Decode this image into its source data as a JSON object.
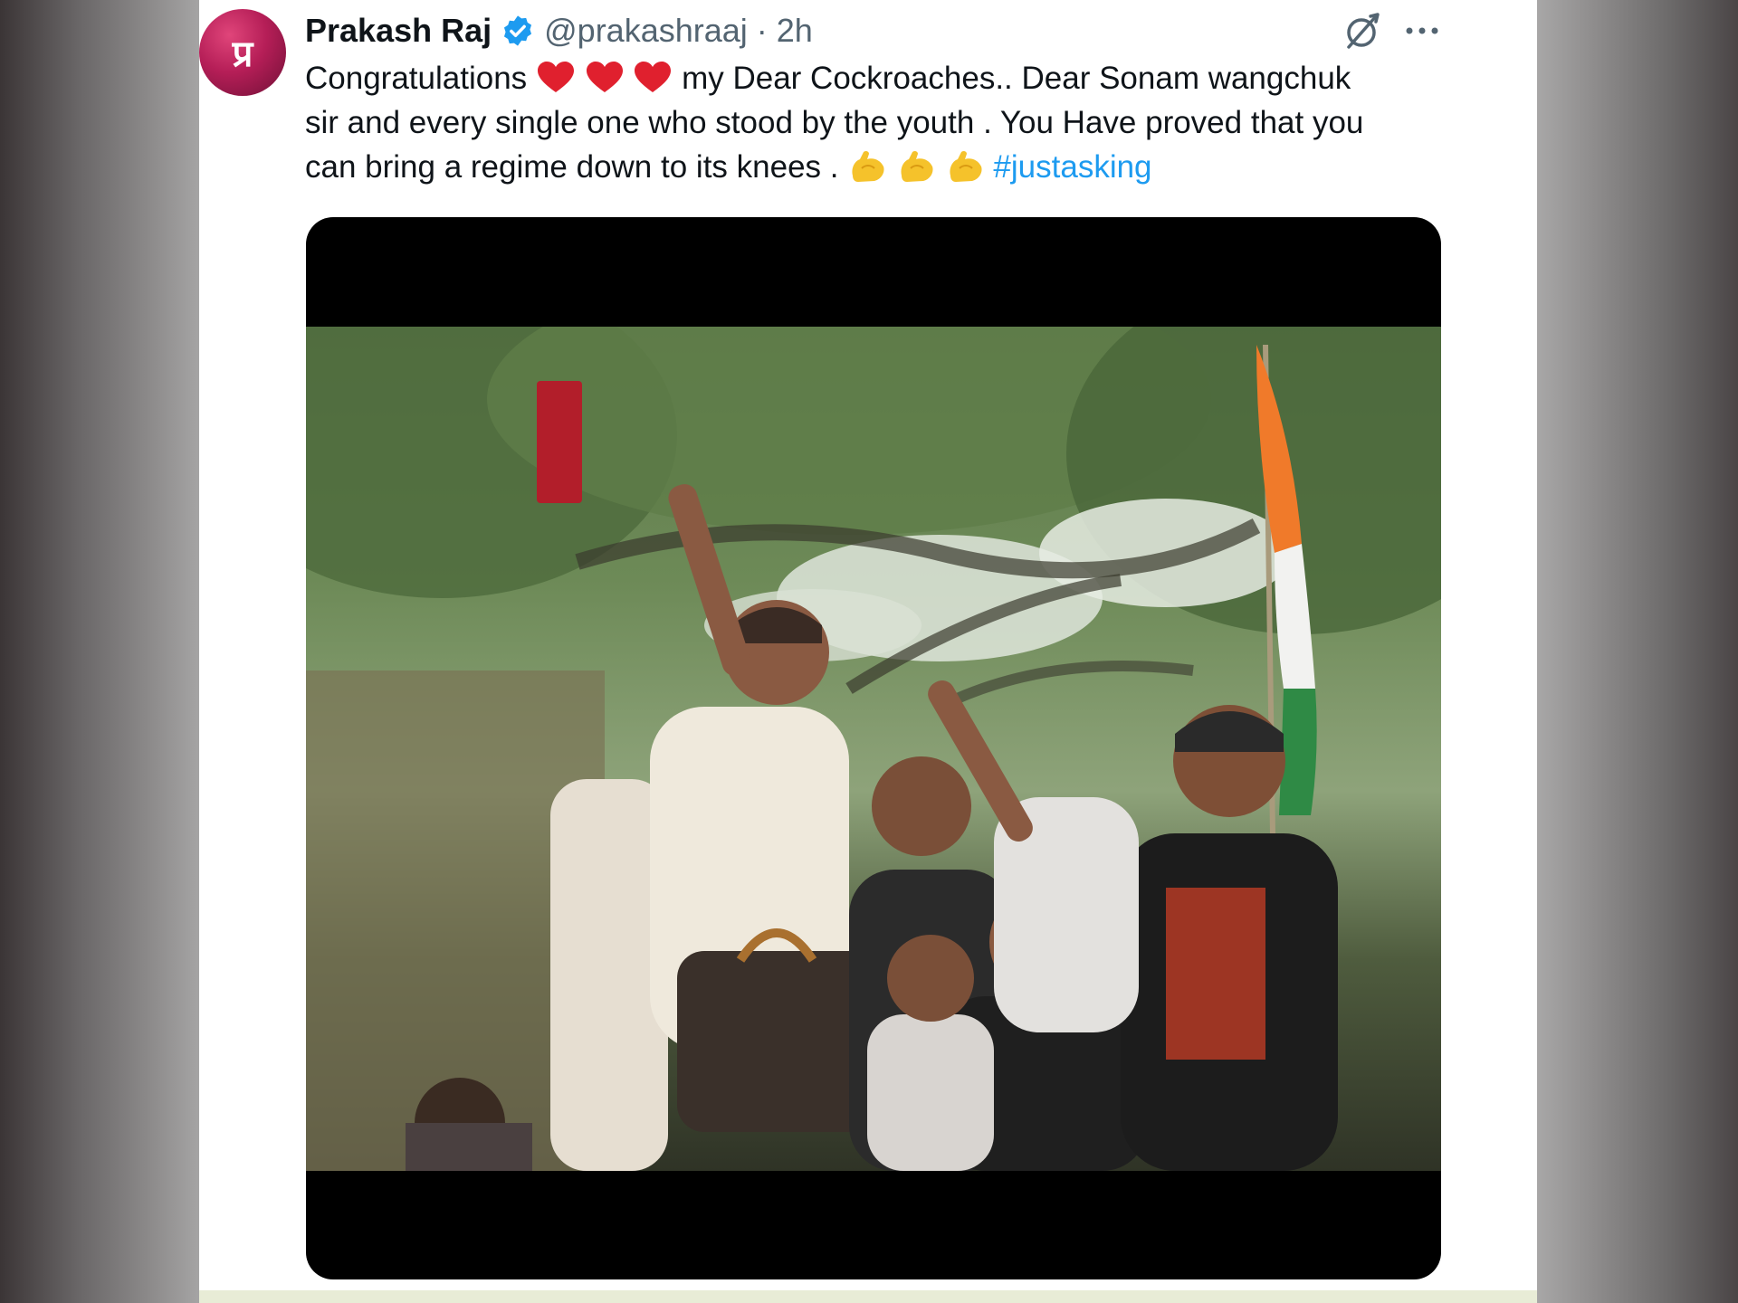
{
  "tweet": {
    "author_name": "Prakash Raj",
    "handle": "@prakashraaj",
    "separator": "·",
    "time": "2h",
    "avatar_text": "प्र",
    "text_line1_a": "Congratulations ",
    "text_line1_b": " my Dear Cockroaches.. Dear Sonam wangchuk",
    "text_line2": "sir and every single one who stood by the youth . You Have proved that you",
    "text_line3_a": "can bring a regime down to its knees . ",
    "hashtag": "#justasking",
    "emoji_hearts": 3,
    "emoji_flex": 3
  },
  "icons": {
    "verified": "verified-badge-icon",
    "grok": "grok-icon",
    "more": "more-icon"
  },
  "colors": {
    "hashtag": "#1d9bf0",
    "verified": "#1d9bf0",
    "avatar": "#b51e57",
    "heart": "#e0202e",
    "flex": "#f5c22b"
  }
}
